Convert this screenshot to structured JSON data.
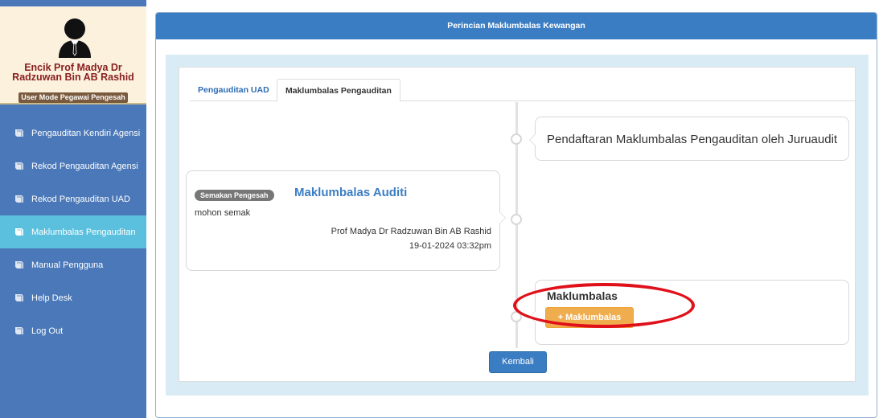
{
  "profile": {
    "name": "Encik Prof Madya Dr Radzuwan Bin AB Rashid",
    "mode": "User Mode Pegawai Pengesah"
  },
  "sidebar": {
    "items": [
      {
        "label": "Pengauditan Kendiri Agensi",
        "icon": "book-icon",
        "active": false
      },
      {
        "label": "Rekod Pengauditan Agensi",
        "icon": "book-icon",
        "active": false
      },
      {
        "label": "Rekod Pengauditan UAD",
        "icon": "book-icon",
        "active": false
      },
      {
        "label": "Maklumbalas Pengauditan",
        "icon": "book-icon",
        "active": true
      },
      {
        "label": "Manual Pengguna",
        "icon": "book-icon",
        "active": false
      },
      {
        "label": "Help Desk",
        "icon": "book-icon",
        "active": false
      },
      {
        "label": "Log Out",
        "icon": "book-icon",
        "active": false
      }
    ]
  },
  "main": {
    "header": "Perincian Maklumbalas Kewangan",
    "tabs": [
      {
        "label": "Pengauditan UAD"
      },
      {
        "label": "Maklumbalas Pengauditan"
      }
    ],
    "timeline": {
      "entry1": {
        "title": "Pendaftaran Maklumbalas Pengauditan oleh Juruaudit"
      },
      "entry2": {
        "badge": "Semakan Pengesah",
        "title": "Maklumbalas Auditi",
        "body": "mohon semak",
        "name": "Prof Madya Dr Radzuwan Bin AB Rashid",
        "date": "19-01-2024 03:32pm"
      },
      "entry3": {
        "title": "Maklumbalas",
        "button": "+ Maklumbalas"
      }
    },
    "back_button": "Kembali"
  },
  "colors": {
    "sidebar": "#4a78b8",
    "sidebar_active": "#5bc0de",
    "header": "#3b7dc3",
    "profile_bg": "#fbf1dd",
    "profile_name": "#8a2020",
    "warning_button": "#f0ad4e",
    "annotation": "#e0101a"
  }
}
